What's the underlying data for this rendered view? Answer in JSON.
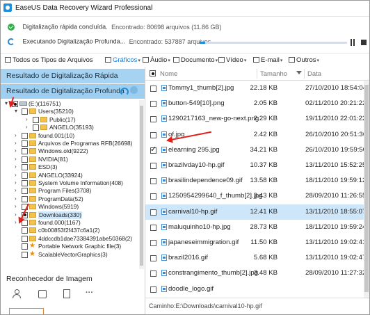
{
  "app": {
    "title": "EaseUS Data Recovery Wizard Professional"
  },
  "status": {
    "quick": {
      "label": "Digitalização rápida concluída.",
      "found": "Encontrado: 80698 arquivos (11.86 GB)"
    },
    "deep": {
      "label": "Executando Digitalização Profunda...",
      "found": "Encontrado: 537887 arquivos",
      "progress": 0.04
    }
  },
  "filters": [
    {
      "label": "Todos os Tipos de Arquivos",
      "icon": "monitor-icon",
      "caret": ""
    },
    {
      "label": "Gráficos",
      "icon": "picture-icon",
      "caret": "▾",
      "active": true
    },
    {
      "label": "Áudio",
      "icon": "music-icon",
      "caret": "▾"
    },
    {
      "label": "Documento",
      "icon": "document-icon",
      "caret": "▾"
    },
    {
      "label": "Vídeo",
      "icon": "video-icon",
      "caret": "▾"
    },
    {
      "label": "E-mail",
      "icon": "mail-icon",
      "caret": "▾"
    },
    {
      "label": "Outros",
      "icon": "folder-icon",
      "caret": "▾"
    }
  ],
  "left": {
    "quick_scan": "Resultado de Digitalização Rápida",
    "deep_scan": "Resultado de Digitalização Profunda",
    "tree": [
      {
        "label": "(E:)(116751)",
        "exp": "▾",
        "cb": "dot",
        "type": "drive",
        "lvl": 0
      },
      {
        "label": "Users(35210)",
        "exp": "▾",
        "cb": "",
        "type": "folder",
        "lvl": 1
      },
      {
        "label": "Public(17)",
        "exp": "›",
        "cb": "",
        "type": "folder",
        "lvl": 2
      },
      {
        "label": "ANGELO(35193)",
        "exp": "›",
        "cb": "",
        "type": "folder",
        "lvl": 2
      },
      {
        "label": "found.001(10)",
        "exp": "›",
        "cb": "",
        "type": "folder",
        "lvl": 1
      },
      {
        "label": "Arquivos de Programas RFB(26698)",
        "exp": "›",
        "cb": "",
        "type": "folder",
        "lvl": 1
      },
      {
        "label": "Windows.old(9222)",
        "exp": "›",
        "cb": "",
        "type": "folder",
        "lvl": 1
      },
      {
        "label": "NVIDIA(81)",
        "exp": "›",
        "cb": "",
        "type": "folder",
        "lvl": 1
      },
      {
        "label": "ESD(3)",
        "exp": "›",
        "cb": "",
        "type": "folder",
        "lvl": 1
      },
      {
        "label": "ANGELO(33924)",
        "exp": "›",
        "cb": "",
        "type": "folder",
        "lvl": 1
      },
      {
        "label": "System Volume Information(408)",
        "exp": "›",
        "cb": "",
        "type": "folder",
        "lvl": 1
      },
      {
        "label": "Program Files(3708)",
        "exp": "›",
        "cb": "",
        "type": "folder",
        "lvl": 1
      },
      {
        "label": "ProgramData(52)",
        "exp": "›",
        "cb": "",
        "type": "folder",
        "lvl": 1
      },
      {
        "label": "Windows(5919)",
        "exp": "›",
        "cb": "",
        "type": "folder",
        "lvl": 1
      },
      {
        "label": "Downloads(330)",
        "exp": "›",
        "cb": "dot",
        "type": "folder",
        "lvl": 1,
        "selected": true
      },
      {
        "label": "found.000(1167)",
        "exp": "›",
        "cb": "",
        "type": "folder",
        "lvl": 1
      },
      {
        "label": "c0b00853f2f437c6a1(2)",
        "exp": "",
        "cb": "",
        "type": "folder",
        "lvl": 1
      },
      {
        "label": "4ddccdb1dae73384391abe50368(2)",
        "exp": "",
        "cb": "",
        "type": "folder",
        "lvl": 1
      },
      {
        "label": "Portable Network Graphic file(3)",
        "exp": "",
        "cb": "",
        "type": "star",
        "lvl": 1
      },
      {
        "label": "ScalableVectorGraphics(3)",
        "exp": "",
        "cb": "",
        "type": "star",
        "lvl": 1
      }
    ],
    "recognizer": "Reconhecedor de Imagem"
  },
  "table": {
    "headers": {
      "name": "Nome",
      "size": "Tamanho",
      "date": "Data"
    },
    "rows": [
      {
        "name": "Tommy1_thumb[2].jpg",
        "size": "22.18 KB",
        "date": "27/10/2010 18:54:04"
      },
      {
        "name": "button-549[10].png",
        "size": "2.05 KB",
        "date": "02/11/2010 20:21:22"
      },
      {
        "name": "1290217163_new-go-next.png",
        "size": "2.29 KB",
        "date": "19/11/2010 22:01:22"
      },
      {
        "name": "of.jpg",
        "size": "2.42 KB",
        "date": "26/10/2010 20:51:36"
      },
      {
        "name": "elearning 295.jpg",
        "size": "34.21 KB",
        "date": "26/10/2010 19:59:50",
        "checked": true
      },
      {
        "name": "brazilvday10-hp.gif",
        "size": "10.37 KB",
        "date": "13/11/2010 15:52:25"
      },
      {
        "name": "brasilindependence09.gif",
        "size": "13.58 KB",
        "date": "18/11/2010 19:59:12"
      },
      {
        "name": "1250954299640_f_thumb[2].jpg",
        "size": "3.43 KB",
        "date": "28/09/2010 11:26:55"
      },
      {
        "name": "carnival10-hp.gif",
        "size": "12.41 KB",
        "date": "13/11/2010 18:55:07",
        "selected": true
      },
      {
        "name": "maluquinho10-hp.jpg",
        "size": "28.73 KB",
        "date": "18/11/2010 19:59:24"
      },
      {
        "name": "japaneseimmigration.gif",
        "size": "11.50 KB",
        "date": "13/11/2010 19:02:41"
      },
      {
        "name": "brazil2016.gif",
        "size": "5.68 KB",
        "date": "13/11/2010 19:02:47"
      },
      {
        "name": "constrangimento_thumb[2].jpg",
        "size": "3.48 KB",
        "date": "28/09/2010 11:27:32"
      },
      {
        "name": "doodle_logo.gif",
        "size": "",
        "date": ""
      }
    ]
  },
  "path": "Caminho:E:\\Downloads\\carnival10-hp.gif",
  "colors": {
    "accent": "#1e8fd8",
    "header_bg": "#a6d3f2",
    "selected_row": "#cde6fa",
    "annotation": "#e0201c"
  }
}
